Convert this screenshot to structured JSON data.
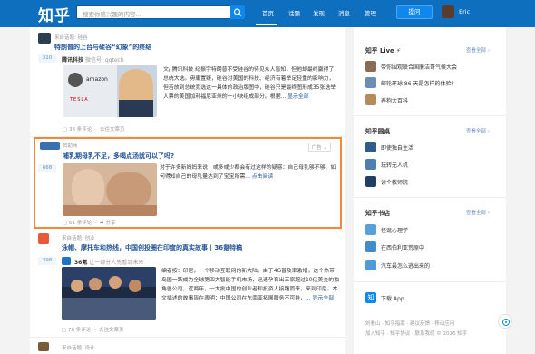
{
  "topbar": {
    "logo": "知乎",
    "search_placeholder": "搜索你感兴趣的内容...",
    "nav": [
      "首页",
      "话题",
      "发现",
      "消息",
      "管理"
    ],
    "ask_label": "提问",
    "user_name": "Eric"
  },
  "feed": [
    {
      "topic_from": "来自话题: 硅谷",
      "title": "特朗普的上台与硅谷“幻象”的终结",
      "votes": "310",
      "author": "腾讯科技",
      "author_bio": "微信号: qqtech",
      "excerpt": "文/ 腾讯科技 纪振宇特朗普不受硅谷的待见众人皆知，但他却最终赢得了总统大选。毋庸置疑，硅谷对美国的科技、经济有着举足轻重的影响力，但若放到总统竞选这一具体的政治版图中，硅谷只是最终图形成35张选举人票的美国加利福尼亚州的一小块组成部分。根据...",
      "more_label": "显示全部",
      "comments": "38 条评论",
      "collapse": "去往文章页",
      "thumb_words": [
        "amazon",
        "TESLA"
      ]
    },
    {
      "source": "赞助商",
      "ad_tag": "广告",
      "title": "哺乳期母乳不足，多喝点汤就可以了吗?",
      "votes": "668",
      "excerpt": "对于许多新妈妈来说，或多或少都会有过这样的疑惑：自己母乳够不够、如何得知自己的母乳量达到了宝宝所需...",
      "more_label": "点击阅读",
      "comments": "61 条评论",
      "share": "分享"
    },
    {
      "topic_from": "来自话题: 创业",
      "title": "泳帽、摩托车和热线，中国创投圈在印度的真实故事 | 36氪特稿",
      "votes": "398",
      "author": "36氪",
      "author_bio": "让一部分人先看到未来",
      "excerpt": "编者按：印尼，一个移动互联网的新大陆。由于4G普及率激增，这个热带岛国一跃成为全球第四大智能手机市场，迅速孕育出三家超过10亿美金的独角兽公司。近两年，一大批中国的创业者和投资人接踵而来，来到印尼。本文描述的故事皆在表明：中国公司在东南亚拓展服务不可挂，...",
      "more_label": "显示全部",
      "comments": "76 条评论",
      "collapse": "去往文章页"
    },
    {
      "topic_from": "来自话题: 设计"
    }
  ],
  "sidebar": {
    "live": {
      "title": "知乎 Live ⚡",
      "more": "查看全部 ›",
      "items": [
        "带你围观联合国廉洁哥气候大会",
        "邮轮环球 86 天是怎样的体验?",
        "养狗大百科"
      ]
    },
    "roundtable": {
      "title": "知乎圆桌",
      "more": "查看全部 ›",
      "items": [
        "即使独自生活",
        "玩转无人机",
        "读个教师院"
      ]
    },
    "books": {
      "title": "知乎书店",
      "more": "查看全部 ›",
      "items": [
        "怪诞心理学",
        "在西伯利亚荒原中",
        "汽车最怎么逃出来的"
      ]
    },
    "download": "下载 App",
    "footer_line1": "刘看山 · 知乎指南 · 建议反馈 · 移动应用",
    "footer_line2": "加入知乎 · 知乎协议 · 联系我们 © 2016 知乎"
  },
  "colors": {
    "brand": "#0e6fbf",
    "link": "#225599",
    "ad_border": "#f2893a"
  }
}
